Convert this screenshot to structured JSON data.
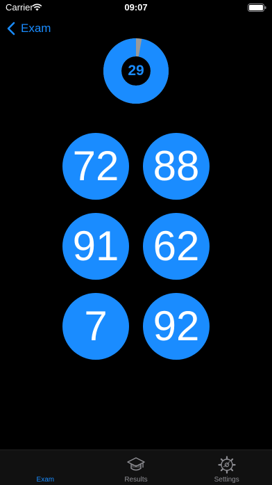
{
  "status_bar": {
    "carrier": "Carrier",
    "time": "09:07",
    "wifi_icon": "wifi-icon",
    "battery_icon": "battery-icon"
  },
  "nav": {
    "back_label": "Exam",
    "back_icon": "chevron-left-icon"
  },
  "timer": {
    "value": "29",
    "remaining_fraction": 0.97
  },
  "answers": [
    "72",
    "88",
    "91",
    "62",
    "7",
    "92"
  ],
  "tabs": [
    {
      "label": "Exam",
      "icon": "exam-icon",
      "active": true
    },
    {
      "label": "Results",
      "icon": "graduation-cap-icon",
      "active": false
    },
    {
      "label": "Settings",
      "icon": "gear-icon",
      "active": false
    }
  ],
  "colors": {
    "accent": "#1a8cff",
    "background": "#000000",
    "timer_elapsed": "#9a9a9a",
    "tab_inactive": "#8e8e93"
  }
}
